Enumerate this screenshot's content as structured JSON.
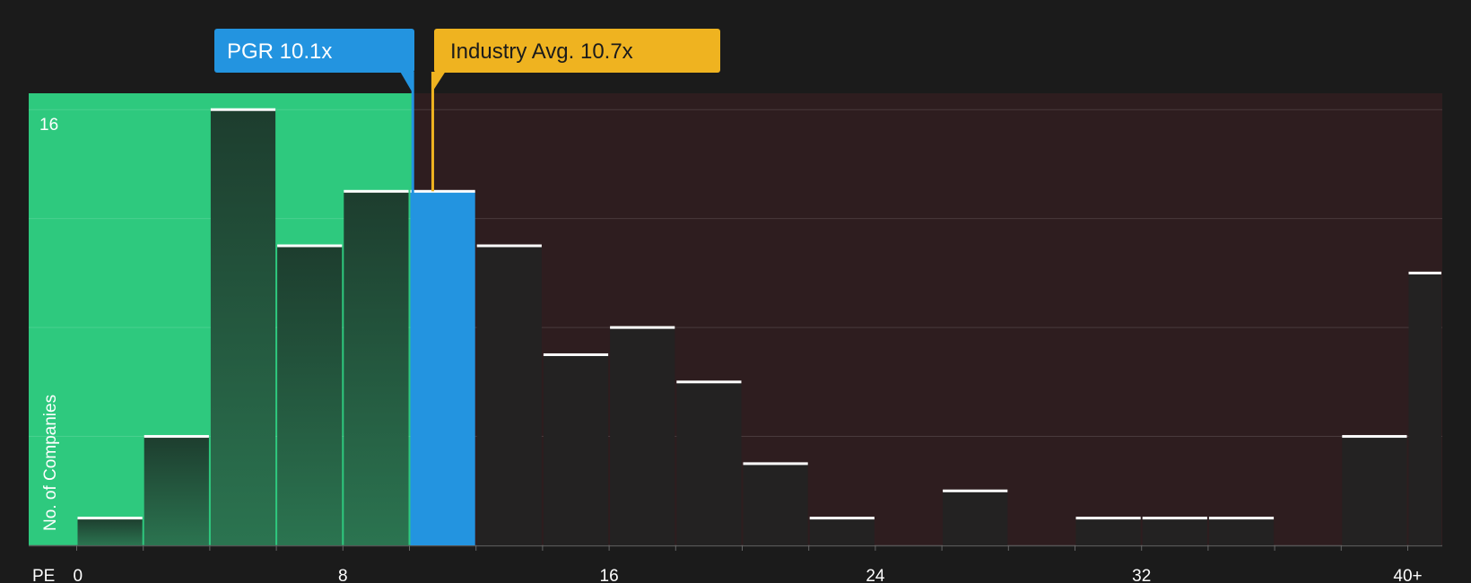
{
  "chart_data": {
    "type": "bar",
    "xlabel": "PE",
    "ylabel": "No. of Companies",
    "x_tick_labels": [
      "0",
      "8",
      "16",
      "24",
      "32",
      "40+"
    ],
    "x_ticks": [
      0,
      8,
      16,
      24,
      32,
      40
    ],
    "y_tick_labels": [
      "16"
    ],
    "y_ticks": [
      16
    ],
    "ylim": [
      0,
      16.6
    ],
    "bin_width": 2,
    "bins_start": [
      0,
      2,
      4,
      6,
      8,
      10,
      12,
      14,
      16,
      18,
      20,
      22,
      24,
      26,
      28,
      30,
      32,
      34,
      36,
      38,
      40
    ],
    "values": [
      1,
      4,
      16,
      11,
      13,
      13,
      11,
      7,
      8,
      6,
      3,
      1,
      0,
      2,
      0,
      1,
      1,
      1,
      0,
      4,
      10
    ],
    "grid": true,
    "highlight": {
      "label": "PGR 10.1x",
      "value": 10.1,
      "color": "#2394e0"
    },
    "industry": {
      "label": "Industry Avg. 10.7x",
      "value": 10.7,
      "color": "#efb320"
    },
    "colors": {
      "background": "#1b1b1b",
      "undervalued_region": "#2ec97e",
      "overvalued_region": "#2e1d1f",
      "bar_dark": "#232222",
      "bar_cap": "#ffffff",
      "highlight_bar": "#2394e0"
    }
  }
}
